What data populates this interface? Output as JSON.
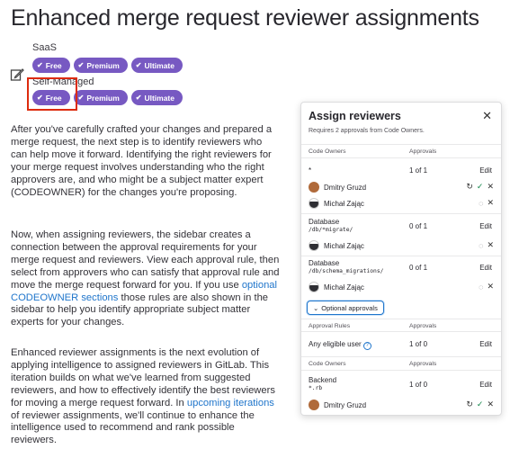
{
  "page": {
    "title": "Enhanced merge request reviewer assignments"
  },
  "tiers": {
    "saas": {
      "label": "SaaS",
      "badges": [
        "Free",
        "Premium",
        "Ultimate"
      ]
    },
    "self_managed": {
      "label": "Self-Managed",
      "badges": [
        "Free",
        "Premium",
        "Ultimate"
      ]
    }
  },
  "article": {
    "p1": "After you've carefully crafted your changes and prepared a merge request, the next step is to identify reviewers who can help move it forward. Identifying the right reviewers for your merge request involves understanding who the right approvers are, and who might be a subject matter expert (CODEOWNER) for the changes you're proposing.",
    "p2_before": "Now, when assigning reviewers, the sidebar creates a connection between the approval requirements for your merge request and reviewers. View each approval rule, then select from approvers who can satisfy that approval rule and move the merge request forward for you. If you use ",
    "p2_link": "optional CODEOWNER sections",
    "p2_after": " those rules are also shown in the sidebar to help you identify appropriate subject matter experts for your changes.",
    "p3_before": "Enhanced reviewer assignments is the next evolution of applying intelligence to assigned reviewers in GitLab. This iteration builds on what we've learned from suggested reviewers, and how to effectively identify the best reviewers for moving a merge request forward. In ",
    "p3_link": "upcoming iterations",
    "p3_after": " of reviewer assignments, we'll continue to enhance the intelligence used to recommend and rank possible reviewers."
  },
  "panel": {
    "title": "Assign reviewers",
    "subtitle": "Requires 2 approvals from Code Owners.",
    "code_owners_header": {
      "col1": "Code Owners",
      "col2": "Approvals"
    },
    "rule1": {
      "name": "*",
      "count": "1 of 1",
      "edit": "Edit",
      "reviewers": [
        "Dmitry Gruzd",
        "Michał Zając"
      ]
    },
    "rule2": {
      "name": "Database",
      "path": "/db/*migrate/",
      "count": "0 of 1",
      "edit": "Edit",
      "reviewers": [
        "Michał Zając"
      ]
    },
    "rule3": {
      "name": "Database",
      "path": "/db/schema_migrations/",
      "count": "0 of 1",
      "edit": "Edit",
      "reviewers": [
        "Michał Zając"
      ]
    },
    "optional_button": "Optional approvals",
    "approval_rules_header": {
      "col1": "Approval Rules",
      "col2": "Approvals"
    },
    "any_user": {
      "name": "Any eligible user",
      "count": "1 of 0",
      "edit": "Edit"
    },
    "code_owners_header2": {
      "col1": "Code Owners",
      "col2": "Approvals"
    },
    "backend": {
      "name": "Backend",
      "path": "*.rb",
      "count": "1 of 0",
      "edit": "Edit",
      "reviewers": [
        "Dmitry Gruzd"
      ]
    },
    "close_icon": "close-icon"
  },
  "colors": {
    "badge": "#7759c2",
    "link": "#1f75cb",
    "highlight": "#dd2b0e",
    "success": "#108548"
  }
}
